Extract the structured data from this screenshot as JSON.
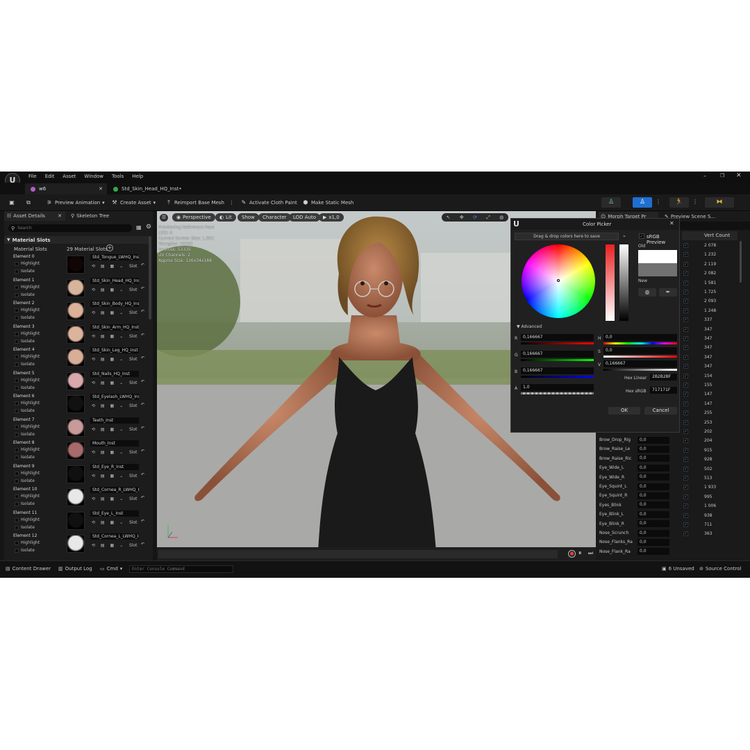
{
  "menu": {
    "items": [
      "File",
      "Edit",
      "Asset",
      "Window",
      "Tools",
      "Help"
    ]
  },
  "tabs": [
    {
      "label": "w6"
    },
    {
      "label": "Std_Skin_Head_HQ_Inst•"
    }
  ],
  "toolbar": {
    "preview_animation": "Preview Animation",
    "create_asset": "Create Asset",
    "reimport": "Reimport Base Mesh",
    "activate_cloth": "Activate Cloth Paint",
    "make_static": "Make Static Mesh"
  },
  "left_panel": {
    "tab_asset_details": "Asset Details",
    "tab_skeleton_tree": "Skeleton Tree",
    "search_placeholder": "Search",
    "section": "Material Slots",
    "material_slots_label": "Material Slots",
    "material_slots_count": "29 Material Slots",
    "highlight": "Highlight",
    "isolate": "Isolate",
    "slot": "Slot",
    "elements": [
      {
        "label": "Element 0",
        "material": "Std_Tongue_LWHQ_Inst",
        "thumb": "#120505"
      },
      {
        "label": "Element 1",
        "material": "Std_Skin_Head_HQ_Inst",
        "thumb": "#d9b49c"
      },
      {
        "label": "Element 2",
        "material": "Std_Skin_Body_HQ_Inst",
        "thumb": "#dcb19a"
      },
      {
        "label": "Element 3",
        "material": "Std_Skin_Arm_HQ_Inst",
        "thumb": "#dcb49e"
      },
      {
        "label": "Element 4",
        "material": "Std_Skin_Leg_HQ_Inst",
        "thumb": "#d9ae98"
      },
      {
        "label": "Element 5",
        "material": "Std_Nails_HQ_Inst",
        "thumb": "#d9a8ad"
      },
      {
        "label": "Element 6",
        "material": "Std_Eyelash_LWHQ_Inst",
        "thumb": "#111111"
      },
      {
        "label": "Element 7",
        "material": "Teeth_Inst",
        "thumb": "#c99a9a"
      },
      {
        "label": "Element 8",
        "material": "Mouth_Inst",
        "thumb": "#a86a6a"
      },
      {
        "label": "Element 9",
        "material": "Std_Eye_R_Inst",
        "thumb": "#101010"
      },
      {
        "label": "Element 10",
        "material": "Std_Cornea_R_LWHQ_Inst",
        "thumb": "#e8e8e8"
      },
      {
        "label": "Element 11",
        "material": "Std_Eye_L_Inst",
        "thumb": "#101010"
      },
      {
        "label": "Element 12",
        "material": "Std_Cornea_L_LWHQ_Inst",
        "thumb": "#e8e8e8"
      }
    ]
  },
  "viewport": {
    "perspective": "Perspective",
    "lit": "Lit",
    "show": "Show",
    "character": "Character",
    "lod_auto": "LOD Auto",
    "speed": "x1,0",
    "info_lines": [
      "Previewing Reference Pose",
      "LOD: 0",
      "Current Screen Size: 1,901",
      "Triangles: 76282",
      "Vertices: 53335",
      "UV Channels: 2",
      "Approx Size: 116x34x188"
    ]
  },
  "right_panel": {
    "tab_morph": "Morph Target Pr",
    "tab_preview_scene": "Preview Scene S...",
    "vert_count_header": "Vert Count",
    "vert_counts": [
      "2 078",
      "1 232",
      "2 119",
      "2 082",
      "1 581",
      "1 725",
      "2 093",
      "1 248",
      "337",
      "347",
      "347",
      "347",
      "347",
      "347",
      "154",
      "155",
      "147",
      "147",
      "255",
      "253",
      "202",
      "204",
      "915",
      "928",
      "502",
      "513",
      "1 933",
      "995",
      "1 006",
      "938",
      "711",
      "363"
    ],
    "morphs": [
      {
        "name": "Brow_Drop_Rig",
        "value": "0,0"
      },
      {
        "name": "Brow_Raise_Le",
        "value": "0,0"
      },
      {
        "name": "Brow_Raise_Ric",
        "value": "0,0"
      },
      {
        "name": "Eye_Wide_L",
        "value": "0,0"
      },
      {
        "name": "Eye_Wide_R",
        "value": "0,0"
      },
      {
        "name": "Eye_Squint_L",
        "value": "0,0"
      },
      {
        "name": "Eye_Squint_R",
        "value": "0,0"
      },
      {
        "name": "Eyes_Blink",
        "value": "0,0"
      },
      {
        "name": "Eye_Blink_L",
        "value": "0,0"
      },
      {
        "name": "Eye_Blink_R",
        "value": "0,0"
      },
      {
        "name": "Nose_Scrunch",
        "value": "0,0"
      },
      {
        "name": "Nose_Flanks_Ra",
        "value": "0,0"
      },
      {
        "name": "Nose_Flank_Ra",
        "value": "0,0"
      }
    ]
  },
  "color_picker": {
    "title": "Color Picker",
    "drag_hint": "Drag & drop colors here to save",
    "srgb_preview": "sRGB Preview",
    "old": "Old",
    "new": "New",
    "advanced": "Advanced",
    "r_label": "R",
    "r_value": "0,166667",
    "g_label": "G",
    "g_value": "0,166667",
    "b_label": "B",
    "b_value": "0,166667",
    "a_label": "A",
    "a_value": "1,0",
    "h_label": "H",
    "h_value": "0,0",
    "s_label": "S",
    "s_value": "0,0",
    "v_label": "V",
    "v_value": "0,166667",
    "hex_linear_label": "Hex Linear",
    "hex_linear": "2B2B2BF",
    "hex_srgb_label": "Hex sRGB",
    "hex_srgb": "717171F",
    "ok": "OK",
    "cancel": "Cancel"
  },
  "statusbar": {
    "content_drawer": "Content Drawer",
    "output_log": "Output Log",
    "cmd": "Cmd",
    "console_placeholder": "Enter Console Command",
    "unsaved": "6 Unsaved",
    "source_control": "Source Control"
  },
  "colors": {
    "accent_blue": "#1f6fd1",
    "check_blue": "#4a90e2",
    "bg": "#151515"
  }
}
